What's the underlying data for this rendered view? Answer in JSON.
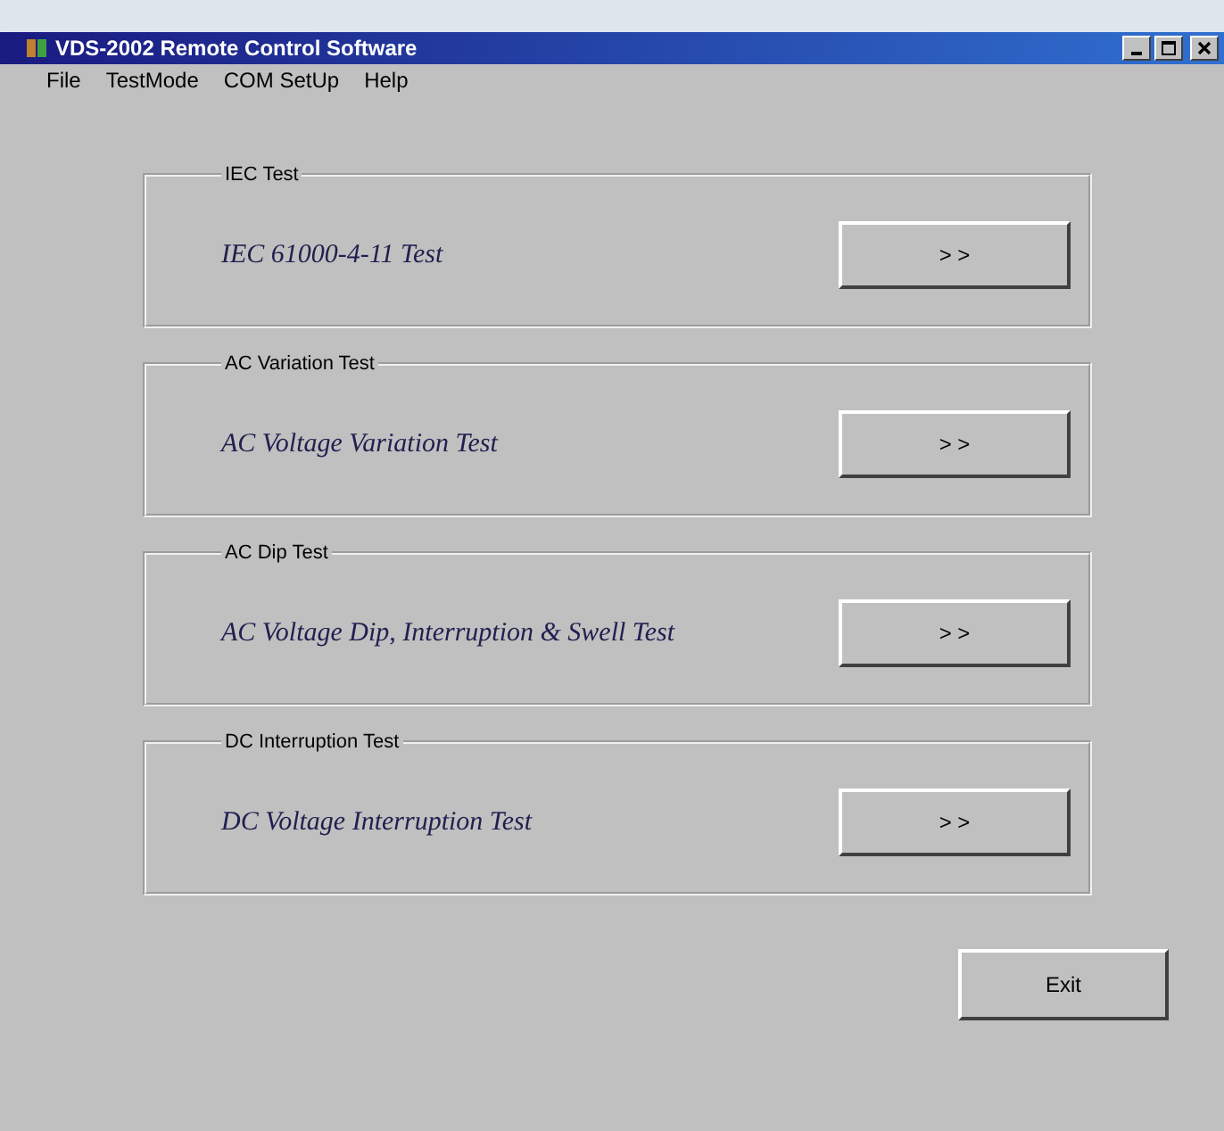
{
  "window": {
    "title": "VDS-2002 Remote Control Software"
  },
  "menu": [
    "File",
    "TestMode",
    "COM SetUp",
    "Help"
  ],
  "groups": [
    {
      "title": "IEC Test",
      "label": "IEC 61000-4-11 Test",
      "button": "> >"
    },
    {
      "title": "AC Variation Test",
      "label": "AC Voltage Variation Test",
      "button": "> >"
    },
    {
      "title": "AC Dip Test",
      "label": "AC Voltage Dip, Interruption & Swell Test",
      "button": "> >"
    },
    {
      "title": "DC Interruption Test",
      "label": "DC Voltage Interruption Test",
      "button": "> >"
    }
  ],
  "exit_button": "Exit"
}
